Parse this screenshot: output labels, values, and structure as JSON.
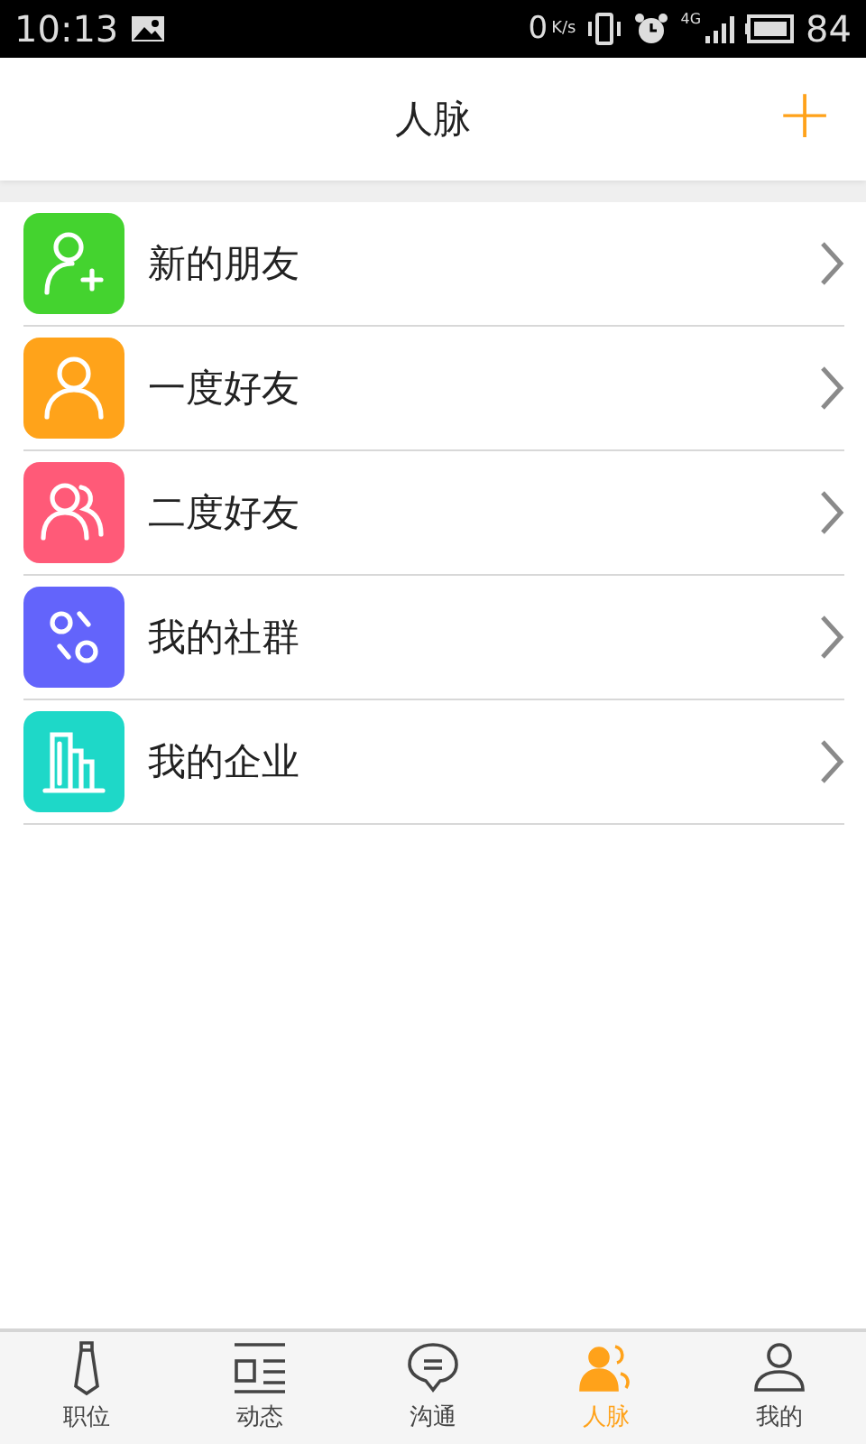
{
  "status_bar": {
    "time": "10:13",
    "speed": "0",
    "speed_unit": "K/s",
    "network": "4G",
    "battery": "84"
  },
  "header": {
    "title": "人脉",
    "action": "+"
  },
  "items": [
    {
      "kind": "add-person",
      "label": "新的朋友",
      "color": "#44d32f"
    },
    {
      "kind": "person",
      "label": "一度好友",
      "color": "#ffa31a"
    },
    {
      "kind": "people",
      "label": "二度好友",
      "color": "#ff5a78"
    },
    {
      "kind": "group",
      "label": "我的社群",
      "color": "#6364fb"
    },
    {
      "kind": "building",
      "label": "我的企业",
      "color": "#1ed8c8"
    }
  ],
  "tabs": [
    {
      "kind": "tie",
      "label": "职位",
      "selected": false
    },
    {
      "kind": "news",
      "label": "动态",
      "selected": false
    },
    {
      "kind": "chat",
      "label": "沟通",
      "selected": false
    },
    {
      "kind": "contacts",
      "label": "人脉",
      "selected": true
    },
    {
      "kind": "profile",
      "label": "我的",
      "selected": false
    }
  ]
}
